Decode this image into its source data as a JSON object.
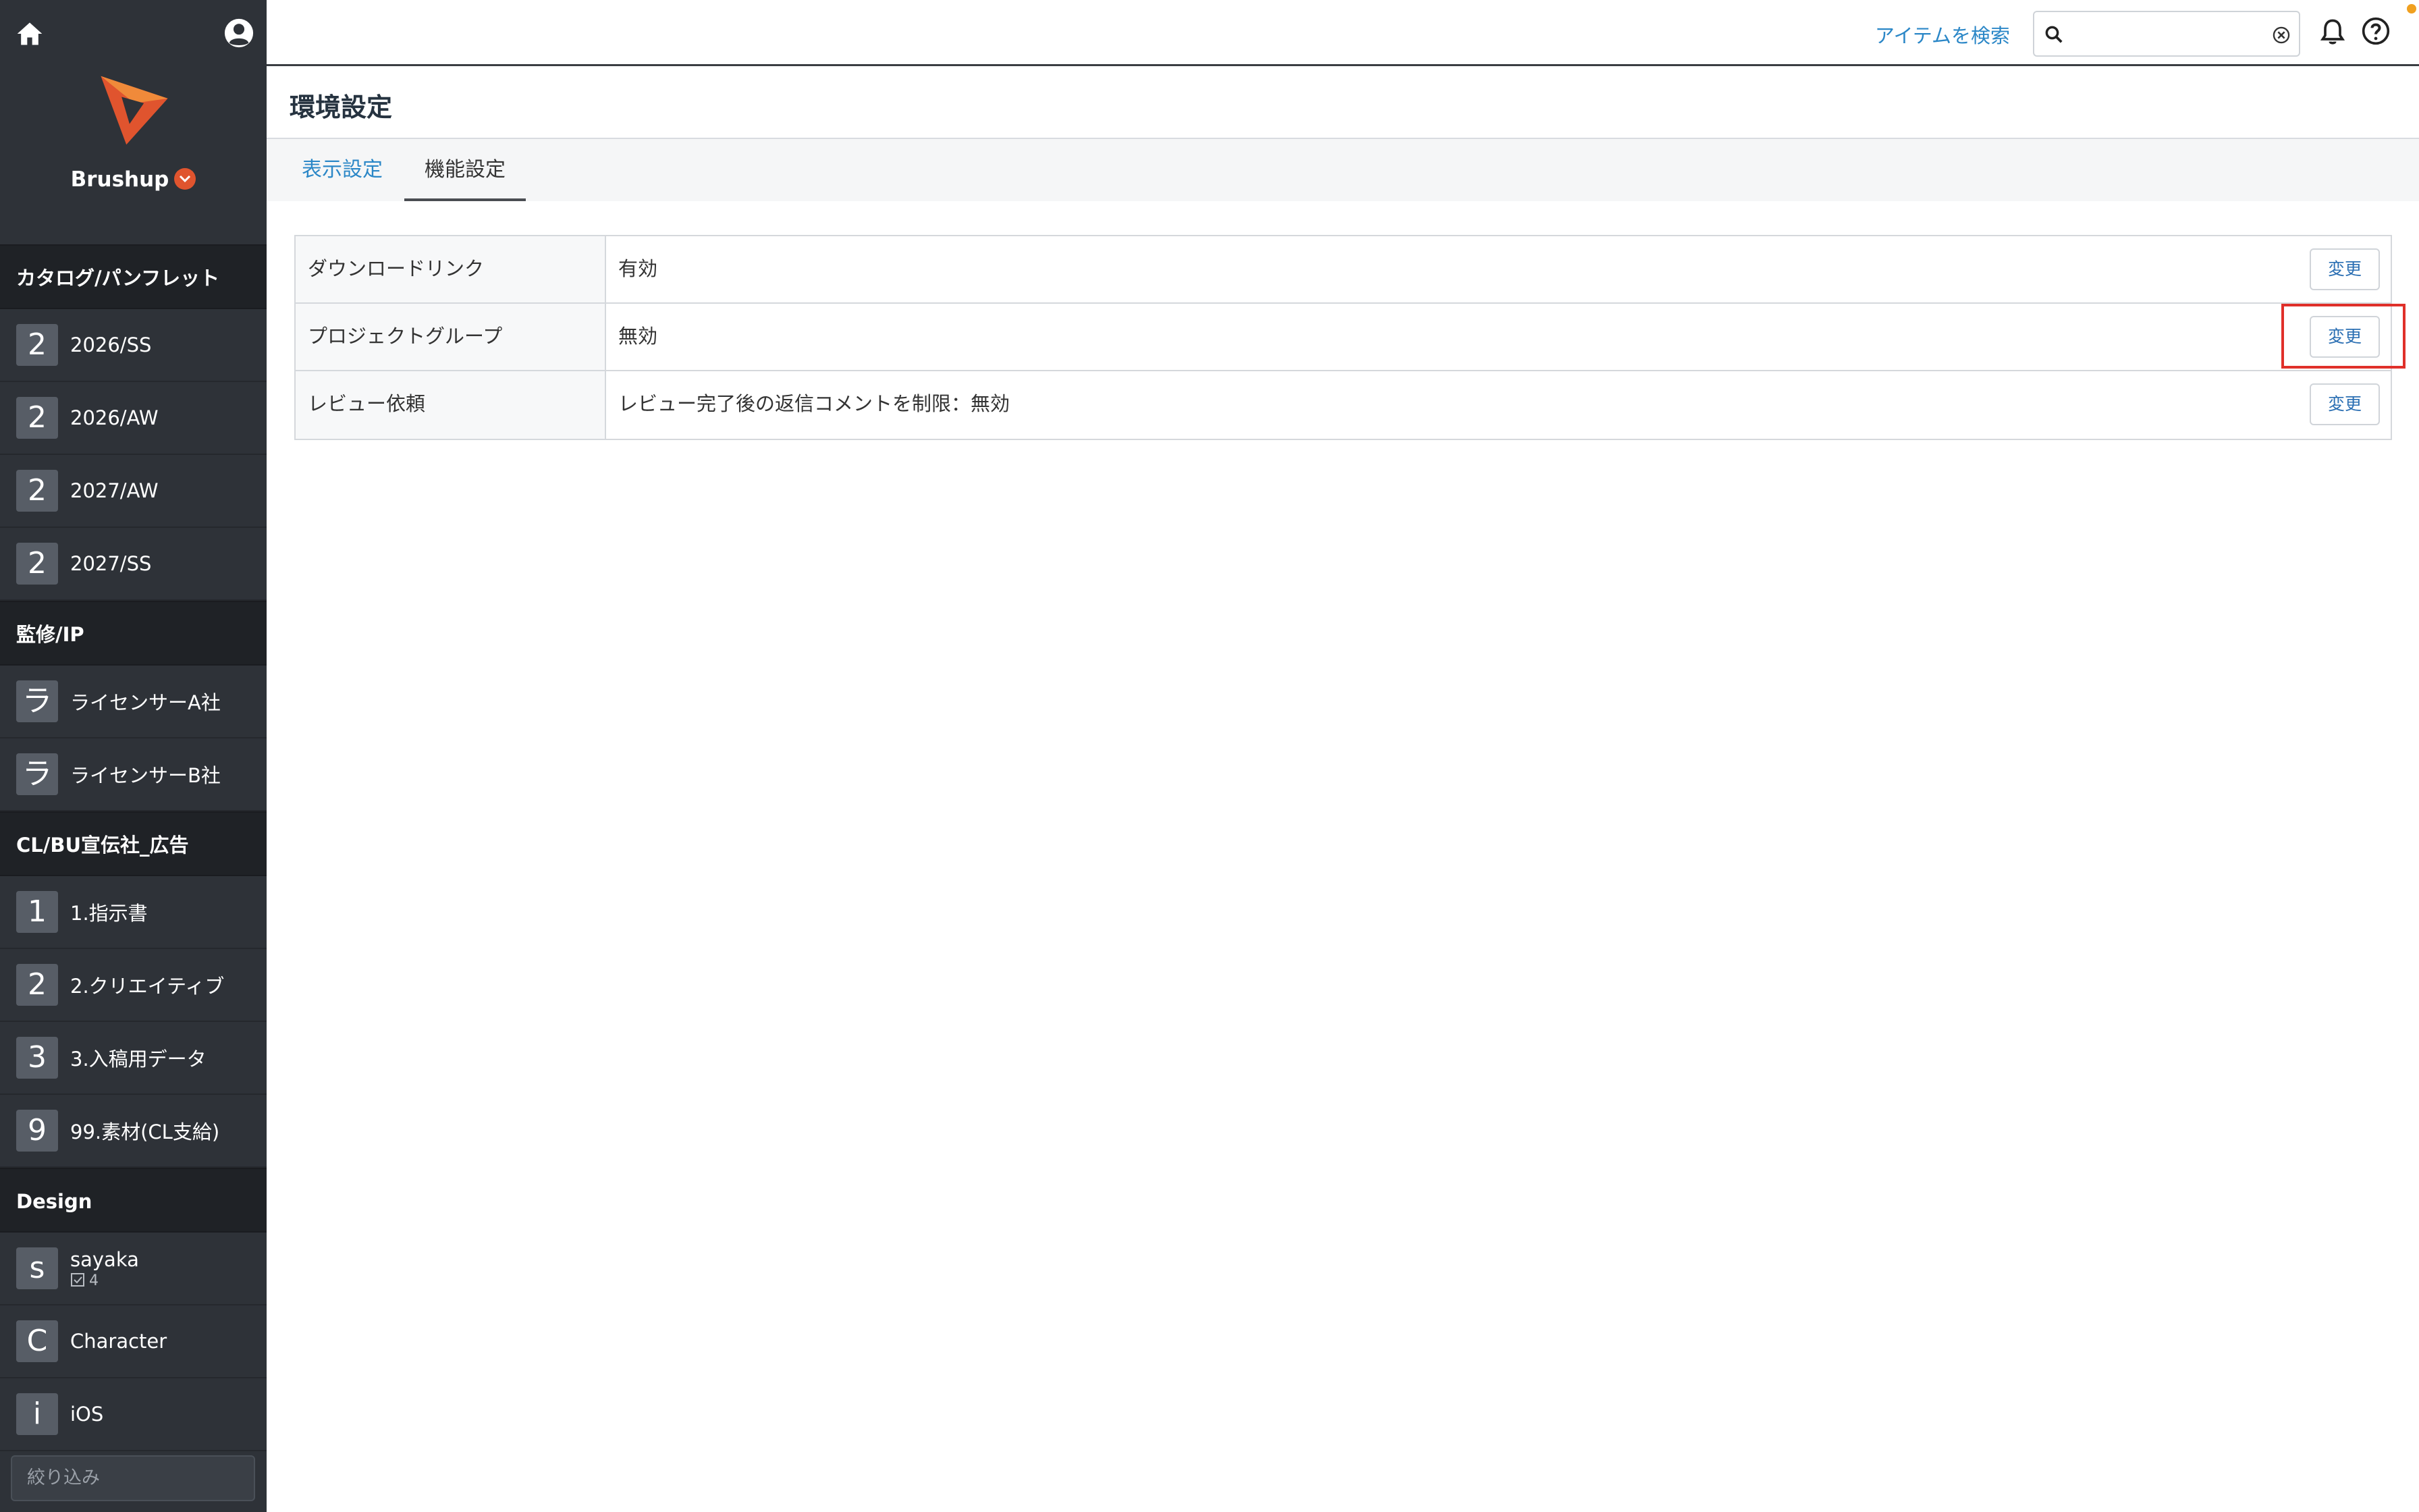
{
  "sidebar": {
    "brand": "Brushup",
    "sections": [
      {
        "title": "カタログ/パンフレット",
        "items": [
          {
            "badge": "2",
            "label": "2026/SS"
          },
          {
            "badge": "2",
            "label": "2026/AW"
          },
          {
            "badge": "2",
            "label": "2027/AW"
          },
          {
            "badge": "2",
            "label": "2027/SS"
          }
        ]
      },
      {
        "title": "監修/IP",
        "items": [
          {
            "badge": "ラ",
            "label": "ライセンサーA社"
          },
          {
            "badge": "ラ",
            "label": "ライセンサーB社"
          }
        ]
      },
      {
        "title": "CL/BU宣伝社_広告",
        "items": [
          {
            "badge": "1",
            "label": "1.指示書"
          },
          {
            "badge": "2",
            "label": "2.クリエイティブ"
          },
          {
            "badge": "3",
            "label": "3.入稿用データ"
          },
          {
            "badge": "9",
            "label": "99.素材(CL支給)"
          }
        ]
      },
      {
        "title": "Design",
        "items": [
          {
            "badge": "s",
            "label": "sayaka",
            "meta": "4"
          },
          {
            "badge": "C",
            "label": "Character"
          },
          {
            "badge": "i",
            "label": "iOS"
          }
        ]
      }
    ],
    "filter_placeholder": "絞り込み"
  },
  "topbar": {
    "search_link": "アイテムを検索",
    "search_value": ""
  },
  "page": {
    "title": "環境設定",
    "tabs": [
      {
        "label": "表示設定",
        "active": false
      },
      {
        "label": "機能設定",
        "active": true
      }
    ],
    "settings": [
      {
        "label": "ダウンロードリンク",
        "value": "有効",
        "button": "変更"
      },
      {
        "label": "プロジェクトグループ",
        "value": "無効",
        "button": "変更"
      },
      {
        "label": "レビュー依頼",
        "value": "レビュー完了後の返信コメントを制限：無効",
        "button": "変更"
      }
    ]
  },
  "colors": {
    "sidebar_bg": "#2e3238",
    "accent_link": "#2b87c7",
    "brand_orange": "#e0542e",
    "highlight_red": "#e0302a"
  },
  "icons": {
    "home": "home-icon",
    "user": "user-icon",
    "search": "search-icon",
    "clear": "clear-icon",
    "bell": "bell-icon",
    "help": "help-icon"
  }
}
